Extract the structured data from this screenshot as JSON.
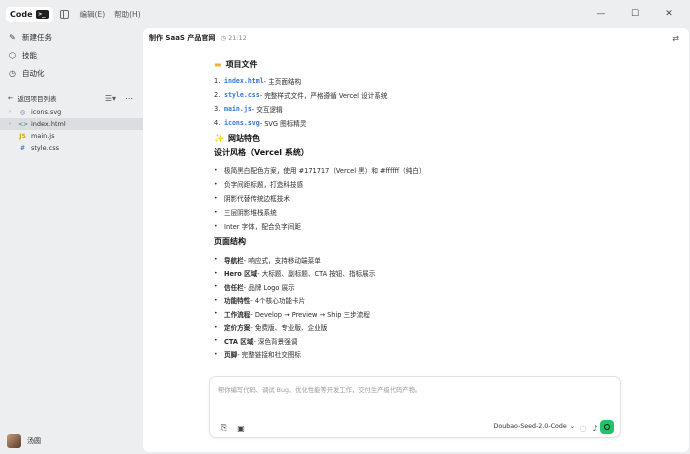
{
  "titlebar": {
    "app_label": "Code",
    "menu": [
      "编辑(E)",
      "帮助(H)"
    ]
  },
  "sidebar": {
    "nav": [
      {
        "label": "新建任务",
        "icon": "edit-icon"
      },
      {
        "label": "技能",
        "icon": "cube-icon"
      },
      {
        "label": "自动化",
        "icon": "clock-icon"
      }
    ],
    "back_label": "返回项目列表",
    "files": [
      {
        "name": "icons.svg",
        "icon": "svg-file-icon",
        "active": false
      },
      {
        "name": "index.html",
        "icon": "html-file-icon",
        "active": true
      },
      {
        "name": "main.js",
        "icon": "js-file-icon",
        "active": false
      },
      {
        "name": "style.css",
        "icon": "css-file-icon",
        "active": false
      }
    ],
    "user_name": "汤圆"
  },
  "chat": {
    "title": "制作 SaaS 产品官网",
    "time": "21:12"
  },
  "doc": {
    "files_heading": "项目文件",
    "files": [
      {
        "n": "1.",
        "code": "index.html",
        "desc": " - 主页面结构"
      },
      {
        "n": "2.",
        "code": "style.css",
        "desc": " - 完整样式文件，严格遵循 Vercel 设计系统"
      },
      {
        "n": "3.",
        "code": "main.js",
        "desc": " - 交互逻辑"
      },
      {
        "n": "4.",
        "code": "icons.svg",
        "desc": " - SVG 图标精灵"
      }
    ],
    "features_heading": "网站特色",
    "design_heading": "设计风格（Vercel 系统）",
    "design_items": [
      "极简黑白配色方案，使用 #171717（Vercel 黑）和 #ffffff（纯白）",
      "负字间距标题，打造科技感",
      "阴影代替传统边框技术",
      "三层阴影堆栈系统",
      "Inter 字体，配合负字间距"
    ],
    "structure_heading": "页面结构",
    "structure_items": [
      {
        "bold": "导航栏",
        "rest": " - 响应式，支持移动端菜单"
      },
      {
        "bold": "Hero 区域",
        "rest": " - 大标题、副标题、CTA 按钮、指标展示"
      },
      {
        "bold": "信任栏",
        "rest": " - 品牌 Logo 展示"
      },
      {
        "bold": "功能特性",
        "rest": " - 4个核心功能卡片"
      },
      {
        "bold": "工作流程",
        "rest": " - Develop → Preview → Ship 三步流程"
      },
      {
        "bold": "定价方案",
        "rest": " - 免费版、专业版、企业版"
      },
      {
        "bold": "CTA 区域",
        "rest": " - 深色背景强调"
      },
      {
        "bold": "页脚",
        "rest": " - 完整链接和社交图标"
      }
    ]
  },
  "composer": {
    "placeholder": "帮你编写代码、调试 Bug、优化性能等开发工作，交付生产级代码产物。",
    "model": "Doubao-Seed-2.0-Code"
  },
  "colors": {
    "accent_green": "#1ec568",
    "code_blue": "#3577d6"
  }
}
